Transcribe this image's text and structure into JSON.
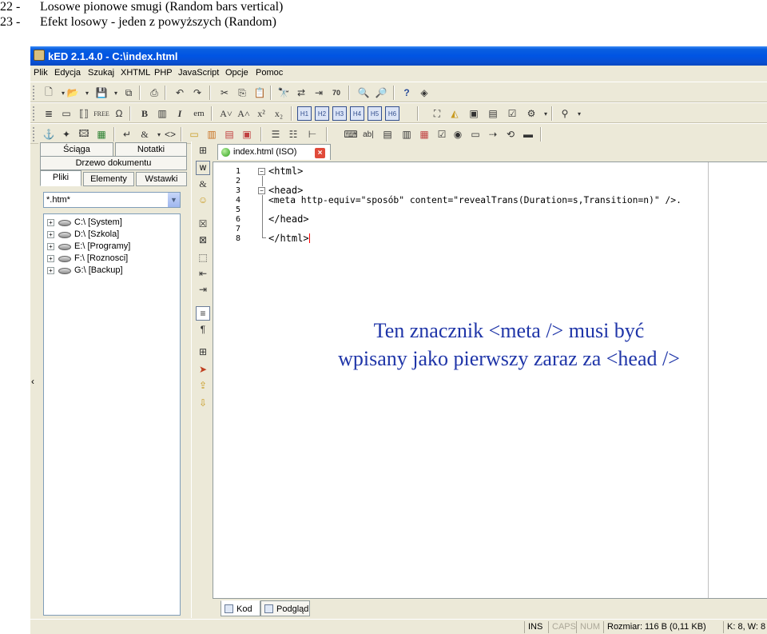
{
  "document": {
    "line22": {
      "num": "22 -",
      "text": "Losowe pionowe smugi (Random bars vertical)"
    },
    "line23": {
      "num": "23 -",
      "text": "Efekt losowy - jeden z powyższych (Random)"
    }
  },
  "window": {
    "title": "kED 2.1.4.0 - C:\\index.html"
  },
  "menu": [
    "Plik",
    "Edycja",
    "Szukaj",
    "XHTML",
    "PHP",
    "JavaScript",
    "Opcje",
    "Pomoc"
  ],
  "toolbar2": {
    "free_label": "FREE",
    "bold_label": "B",
    "italic_label": "I",
    "em_label": "em",
    "headings": [
      "H1",
      "H2",
      "H3",
      "H4",
      "H5",
      "H6"
    ]
  },
  "left_panel": {
    "top_tabs": [
      "Ściąga",
      "Notatki"
    ],
    "tree_tab": "Drzewo dokumentu",
    "sub_tabs": [
      "Pliki",
      "Elementy",
      "Wstawki"
    ],
    "filter_value": "*.htm*",
    "drives": [
      "C:\\ [System]",
      "D:\\ [Szkola]",
      "E:\\ [Programy]",
      "F:\\ [Roznosci]",
      "G:\\ [Backup]"
    ]
  },
  "editor": {
    "tab_label": "index.html (ISO)",
    "line_numbers": [
      "1",
      "2",
      "3",
      "4",
      "5",
      "6",
      "7",
      "8"
    ],
    "code_lines": [
      "<html>",
      "",
      "<head>",
      "<meta http-equiv=\"sposób\" content=\"revealTrans(Duration=s,Transition=n)\" />.",
      "",
      "</head>",
      "",
      "</html>"
    ],
    "annotation_line1": "Ten znacznik <meta /> musi być",
    "annotation_line2": "wpisany jako pierwszy zaraz za <head />",
    "bottom_tabs": [
      "Kod",
      "Podgląd"
    ]
  },
  "status": {
    "ins": "INS",
    "caps": "CAPS",
    "num": "NUM",
    "size": "Rozmiar: 116 B (0,11 KB)",
    "position": "K: 8, W: 8"
  },
  "colors": {
    "titlebar": "#0054e3",
    "annotation": "#1f35a8",
    "chrome": "#ece9d8"
  }
}
